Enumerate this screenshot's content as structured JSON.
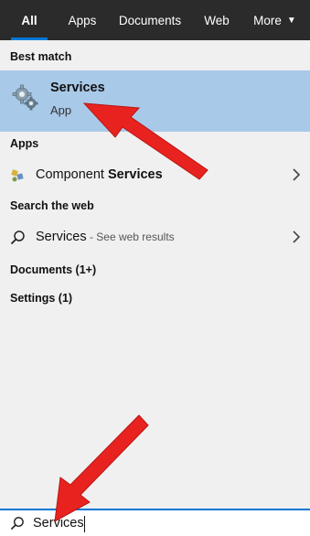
{
  "tabs": [
    {
      "label": "All",
      "active": true
    },
    {
      "label": "Apps",
      "active": false
    },
    {
      "label": "Documents",
      "active": false
    },
    {
      "label": "Web",
      "active": false
    },
    {
      "label": "More",
      "active": false
    }
  ],
  "sections": {
    "best_match": "Best match",
    "apps": "Apps",
    "web": "Search the web",
    "documents": "Documents (1+)",
    "settings": "Settings (1)"
  },
  "best_match": {
    "title": "Services",
    "subtitle": "App",
    "icon": "services-gear-icon"
  },
  "apps": [
    {
      "prefix": "Component ",
      "bold": "Services",
      "icon": "component-services-icon"
    }
  ],
  "web": [
    {
      "term": "Services",
      "hint": " - See web results",
      "icon": "search-icon"
    }
  ],
  "search": {
    "value": "Services"
  },
  "colors": {
    "topbar": "#2b2b2b",
    "accent": "#0078d7",
    "selection": "#a9c9e8",
    "arrow": "#e8231f"
  }
}
